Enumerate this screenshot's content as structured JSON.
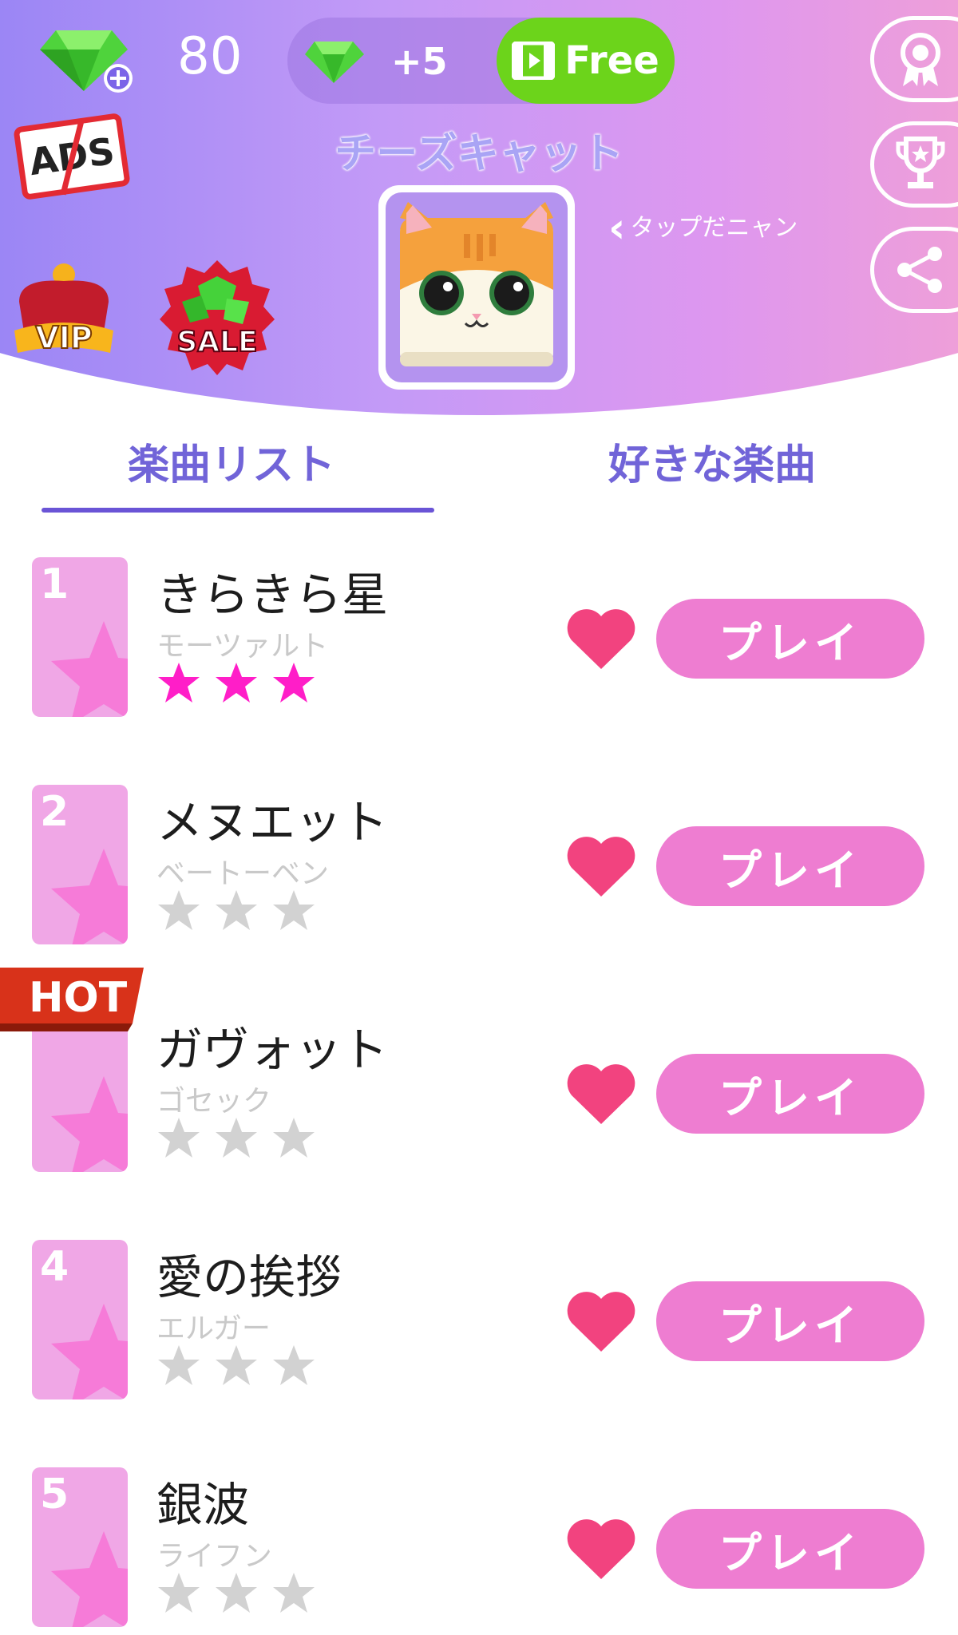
{
  "header": {
    "gem_count": "80",
    "reward": {
      "amount": "+5",
      "free_label": "Free"
    },
    "ads_label": "ADS",
    "character_name": "チーズキャット",
    "tap_hint": "タップだニャン",
    "vip_label": "VIP",
    "sale_label": "SALE",
    "side_buttons": [
      "medal-icon",
      "trophy-icon",
      "share-icon"
    ]
  },
  "tabs": [
    {
      "label": "楽曲リスト",
      "active": true
    },
    {
      "label": "好きな楽曲",
      "active": false
    }
  ],
  "songs": [
    {
      "number": "1",
      "title": "きらきら星",
      "artist": "モーツァルト",
      "stars_earned": 3,
      "stars_total": 3,
      "hot": false,
      "play_label": "プレイ"
    },
    {
      "number": "2",
      "title": "メヌエット",
      "artist": "ベートーベン",
      "stars_earned": 0,
      "stars_total": 3,
      "hot": false,
      "play_label": "プレイ"
    },
    {
      "number": "",
      "title": "ガヴォット",
      "artist": "ゴセック",
      "stars_earned": 0,
      "stars_total": 3,
      "hot": true,
      "hot_label": "HOT",
      "play_label": "プレイ"
    },
    {
      "number": "4",
      "title": "愛の挨拶",
      "artist": "エルガー",
      "stars_earned": 0,
      "stars_total": 3,
      "hot": false,
      "play_label": "プレイ"
    },
    {
      "number": "5",
      "title": "銀波",
      "artist": "ライフン",
      "stars_earned": 0,
      "stars_total": 3,
      "hot": false,
      "play_label": "プレイ"
    }
  ],
  "colors": {
    "accent": "#6a54d6",
    "play_button": "#ee7dd1",
    "heart": "#f2437f",
    "star_earned": "#ff1ec8",
    "star_empty": "#d2d2d2",
    "free_button": "#6cd41b"
  }
}
